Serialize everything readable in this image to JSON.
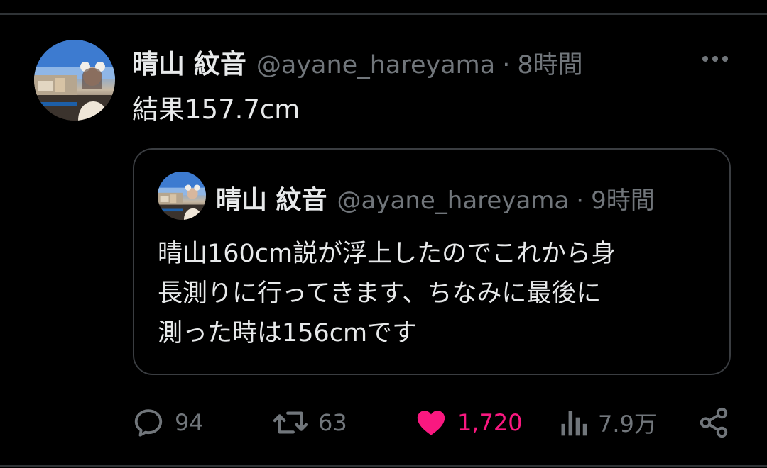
{
  "tweet": {
    "author": {
      "display_name": "晴山 紋音",
      "handle": "@ayane_hareyama",
      "avatar_icon": "profile-photo"
    },
    "separator": "·",
    "time": "8時間",
    "text": "結果157.7cm",
    "more_icon": "more-horizontal-icon"
  },
  "quote": {
    "author": {
      "display_name": "晴山 紋音",
      "handle": "@ayane_hareyama"
    },
    "separator": "·",
    "time": "9時間",
    "lines": [
      "晴山160cm説が浮上したのでこれから身",
      "長測りに行ってきます、ちなみに最後に",
      "測った時は156cmです"
    ]
  },
  "actions": {
    "reply": {
      "icon": "reply-icon",
      "count": "94"
    },
    "retweet": {
      "icon": "retweet-icon",
      "count": "63"
    },
    "like": {
      "icon": "heart-icon",
      "count": "1,720",
      "active": true
    },
    "views": {
      "icon": "views-icon",
      "count": "7.9万"
    },
    "share": {
      "icon": "share-icon"
    }
  },
  "colors": {
    "background": "#000000",
    "text_primary": "#e7e9ea",
    "text_secondary": "#71767b",
    "like_active": "#f91880",
    "border": "#3a3d41"
  }
}
